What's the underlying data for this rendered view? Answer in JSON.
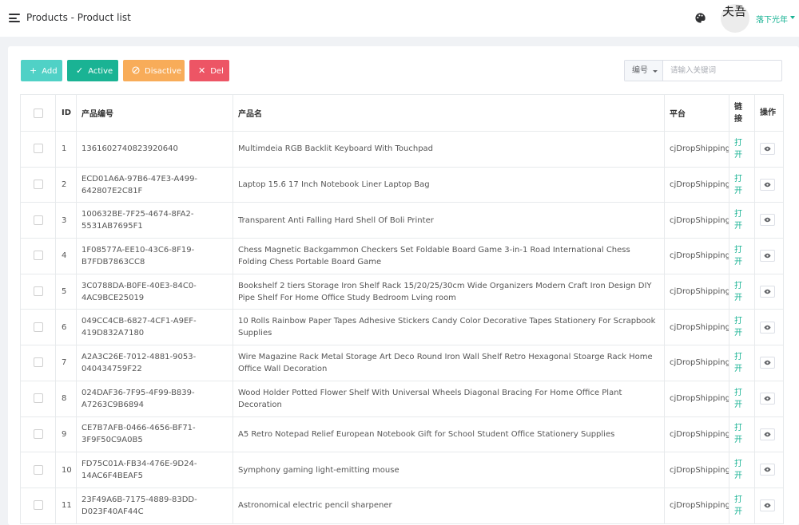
{
  "header": {
    "title": "Products - Product list",
    "avatar_text": "夫吾",
    "user_name": "落下光年"
  },
  "toolbar": {
    "add_label": "Add",
    "active_label": "Active",
    "disactive_label": "Disactive",
    "del_label": "Del"
  },
  "search": {
    "field_select": "编号",
    "placeholder": "请输入关键词"
  },
  "table": {
    "columns": [
      "ID",
      "产品编号",
      "产品名",
      "平台",
      "链接",
      "操作"
    ],
    "rows": [
      {
        "id": "1",
        "code": "1361602740823920640",
        "name": "Multimdeia RGB Backlit Keyboard With Touchpad",
        "platform": "cjDropShipping",
        "link": "打开"
      },
      {
        "id": "2",
        "code": "ECD01A6A-97B6-47E3-A499-642807E2C81F",
        "name": "Laptop 15.6 17 Inch Notebook Liner Laptop Bag",
        "platform": "cjDropShipping",
        "link": "打开"
      },
      {
        "id": "3",
        "code": "100632BE-7F25-4674-8FA2-5531AB7695F1",
        "name": "Transparent Anti Falling Hard Shell Of Boli Printer",
        "platform": "cjDropShipping",
        "link": "打开"
      },
      {
        "id": "4",
        "code": "1F08577A-EE10-43C6-8F19-B7FDB7863CC8",
        "name": "Chess Magnetic Backgammon Checkers Set Foldable Board Game 3-in-1 Road International Chess Folding Chess Portable Board Game",
        "platform": "cjDropShipping",
        "link": "打开"
      },
      {
        "id": "5",
        "code": "3C0788DA-B0FE-40E3-84C0-4AC9BCE25019",
        "name": "Bookshelf 2 tiers Storage Iron Shelf Rack 15/20/25/30cm Wide Organizers Modern Craft Iron Design DIY Pipe Shelf For Home Office Study Bedroom Lving room",
        "platform": "cjDropShipping",
        "link": "打开"
      },
      {
        "id": "6",
        "code": "049CC4CB-6827-4CF1-A9EF-419D832A7180",
        "name": "10 Rolls Rainbow Paper Tapes Adhesive Stickers Candy Color Decorative Tapes Stationery For Scrapbook Supplies",
        "platform": "cjDropShipping",
        "link": "打开"
      },
      {
        "id": "7",
        "code": "A2A3C26E-7012-4881-9053-040434759F22",
        "name": "Wire Magazine Rack Metal Storage Art Deco Round Iron Wall Shelf Retro Hexagonal Stoarge Rack Home Office Wall Decoration",
        "platform": "cjDropShipping",
        "link": "打开"
      },
      {
        "id": "8",
        "code": "024DAF36-7F95-4F99-B839-A7263C9B6894",
        "name": "Wood Holder Potted Flower Shelf With Universal Wheels Diagonal Bracing For Home Office Plant Decoration",
        "platform": "cjDropShipping",
        "link": "打开"
      },
      {
        "id": "9",
        "code": "CE7B7AFB-0466-4656-BF71-3F9F50C9A0B5",
        "name": "A5 Retro Notepad Relief European Notebook Gift for School Student Office Stationery Supplies",
        "platform": "cjDropShipping",
        "link": "打开"
      },
      {
        "id": "10",
        "code": "FD75C01A-FB34-476E-9D24-14AC6F4BEAF5",
        "name": "Symphony gaming light-emitting mouse",
        "platform": "cjDropShipping",
        "link": "打开"
      },
      {
        "id": "11",
        "code": "23F49A6B-7175-4889-83DD-D023F40AF44C",
        "name": "Astronomical electric pencil sharpener",
        "platform": "cjDropShipping",
        "link": "打开"
      }
    ]
  },
  "colors": {
    "accent": "#1ab394",
    "add": "#50d1c6",
    "disactive": "#f8ac59",
    "del": "#ed5565"
  },
  "icons": [
    "menu-icon",
    "palette-icon",
    "chevron-down-icon",
    "plus-icon",
    "check-icon",
    "ban-icon",
    "close-icon",
    "eye-icon"
  ]
}
